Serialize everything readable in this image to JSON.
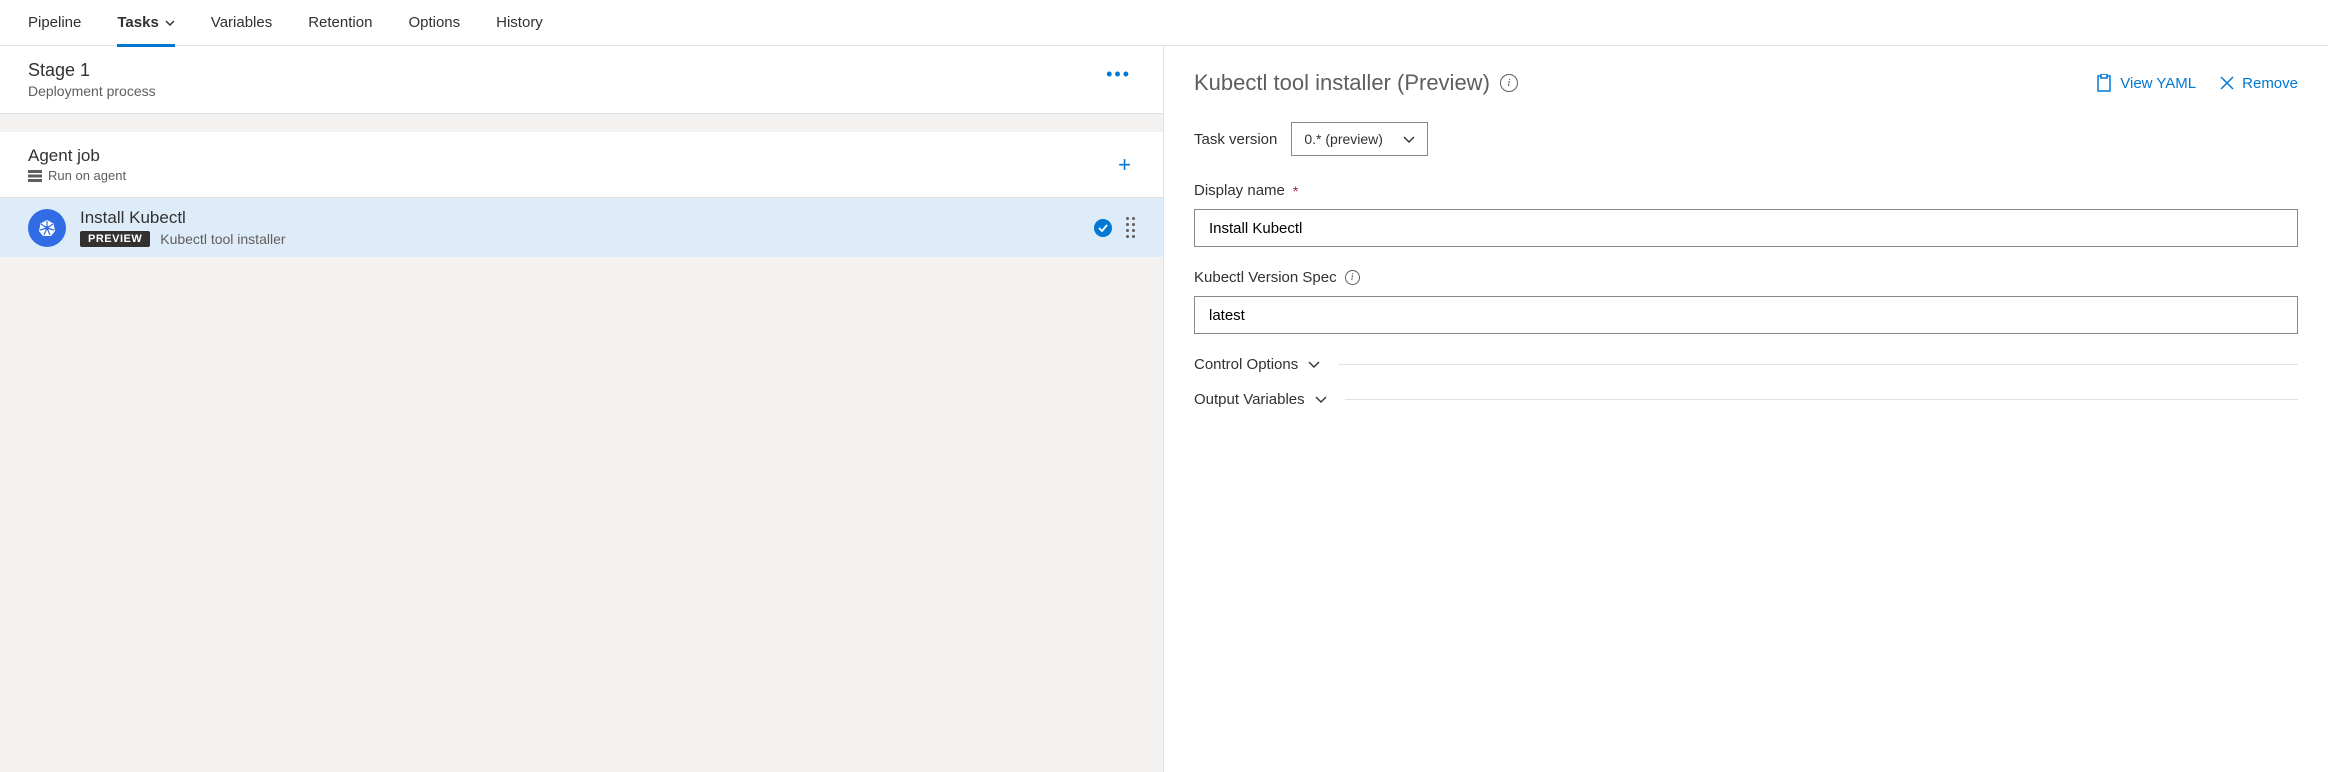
{
  "tabs": {
    "pipeline": "Pipeline",
    "tasks": "Tasks",
    "variables": "Variables",
    "retention": "Retention",
    "options": "Options",
    "history": "History"
  },
  "stage": {
    "title": "Stage 1",
    "subtitle": "Deployment process"
  },
  "agent_job": {
    "title": "Agent job",
    "subtitle": "Run on agent"
  },
  "task": {
    "title": "Install Kubectl",
    "badge": "PREVIEW",
    "subtitle": "Kubectl tool installer"
  },
  "details": {
    "title": "Kubectl tool installer (Preview)",
    "view_yaml": "View YAML",
    "remove": "Remove",
    "task_version_label": "Task version",
    "task_version_value": "0.* (preview)",
    "display_name_label": "Display name",
    "display_name_value": "Install Kubectl",
    "version_spec_label": "Kubectl Version Spec",
    "version_spec_value": "latest",
    "control_options": "Control Options",
    "output_variables": "Output Variables"
  }
}
